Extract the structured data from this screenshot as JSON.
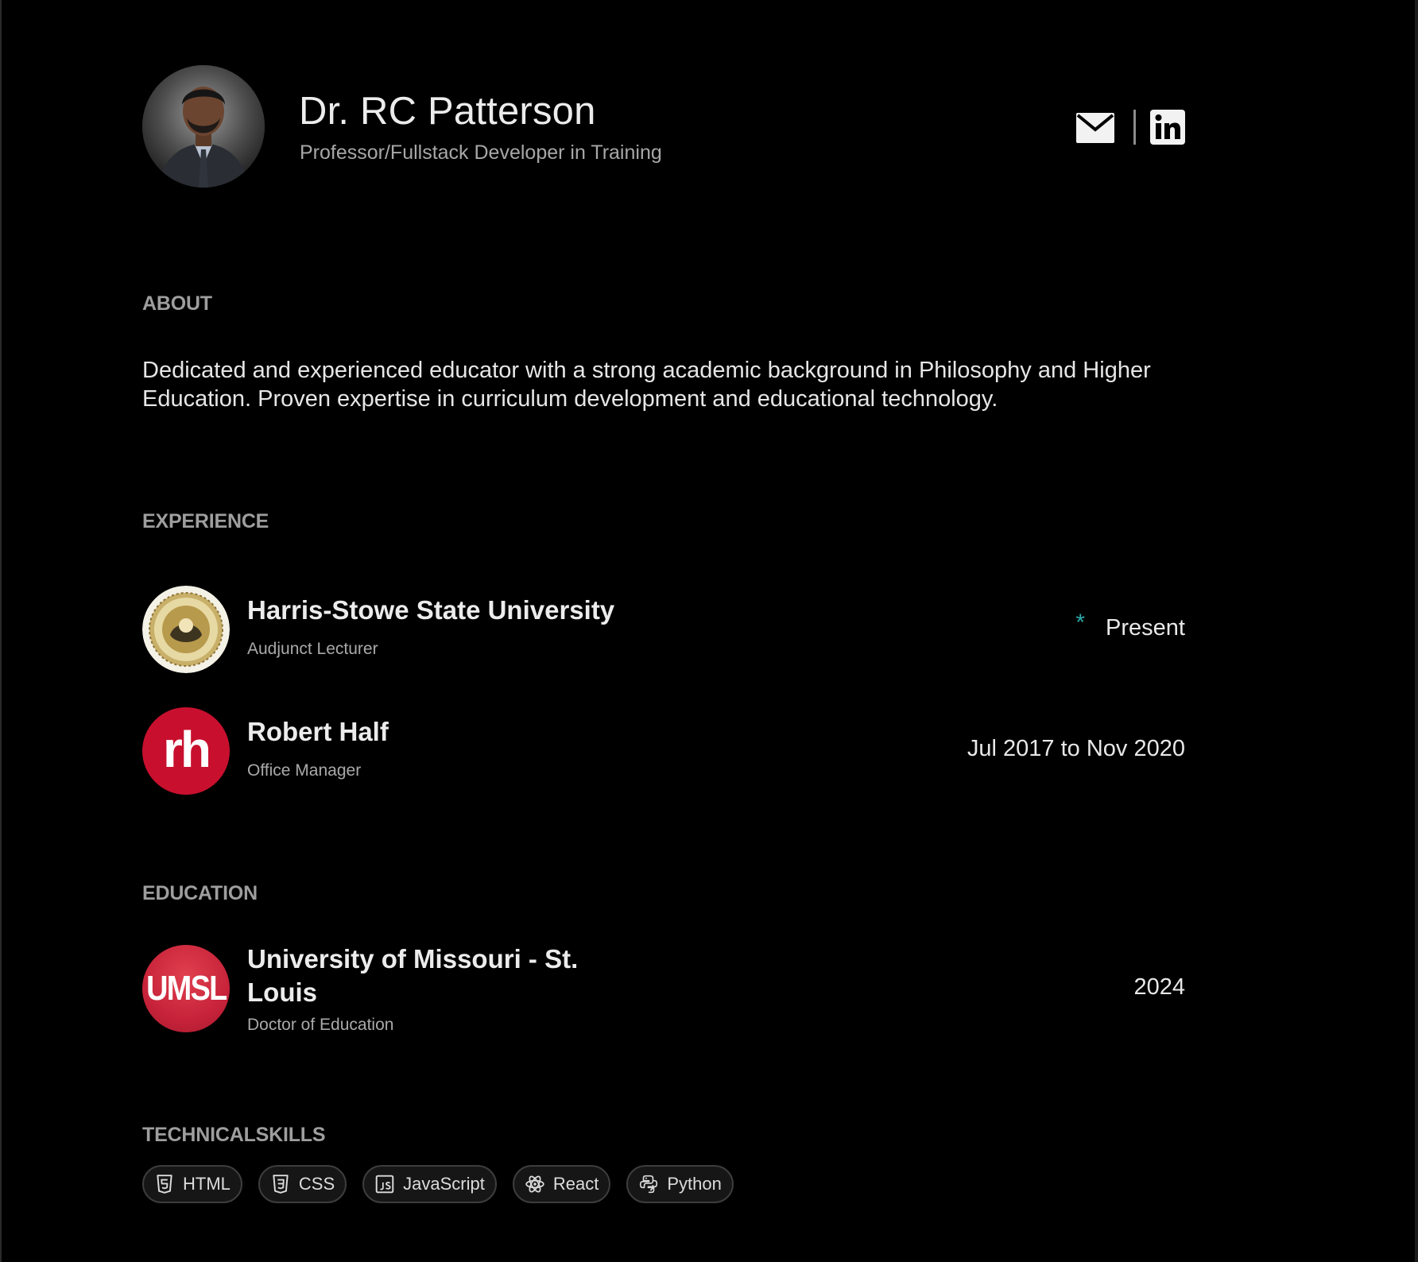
{
  "header": {
    "name": "Dr. RC Patterson",
    "subtitle": "Professor/Fullstack Developer in Training",
    "social": [
      {
        "icon": "mail-icon"
      },
      {
        "icon": "linkedin-icon"
      }
    ]
  },
  "about": {
    "title": "ABOUT",
    "text": "Dedicated and experienced educator with a strong academic background in Philosophy and Higher Education. Proven expertise in curriculum development and educational technology."
  },
  "experience": {
    "title": "EXPERIENCE",
    "items": [
      {
        "org": "Harris-Stowe State University",
        "role": "Audjunct Lecturer",
        "date": "Present",
        "present_marker": "*",
        "logo": "harris-stowe-seal-logo"
      },
      {
        "org": "Robert Half",
        "role": "Office Manager",
        "date": "Jul 2017 to Nov 2020",
        "logo_text": "rh",
        "logo": "robert-half-logo"
      }
    ]
  },
  "education": {
    "title": "EDUCATION",
    "items": [
      {
        "org_line1": "University of Missouri - St.",
        "org_line2": "Louis",
        "role": "Doctor of Education",
        "date": "2024",
        "logo_text": "UMSL",
        "logo": "umsl-logo"
      }
    ]
  },
  "skills": {
    "title": "TECHNICALSKILLS",
    "items": [
      {
        "label": "HTML",
        "icon": "html5-icon"
      },
      {
        "label": "CSS",
        "icon": "css3-icon"
      },
      {
        "label": "JavaScript",
        "icon": "javascript-icon"
      },
      {
        "label": "React",
        "icon": "react-icon"
      },
      {
        "label": "Python",
        "icon": "python-icon"
      }
    ]
  },
  "colors": {
    "background": "#000000",
    "accent_star": "#2aa7a7",
    "robert_half_red": "#c8102e",
    "umsl_red": "#d22d3f"
  }
}
